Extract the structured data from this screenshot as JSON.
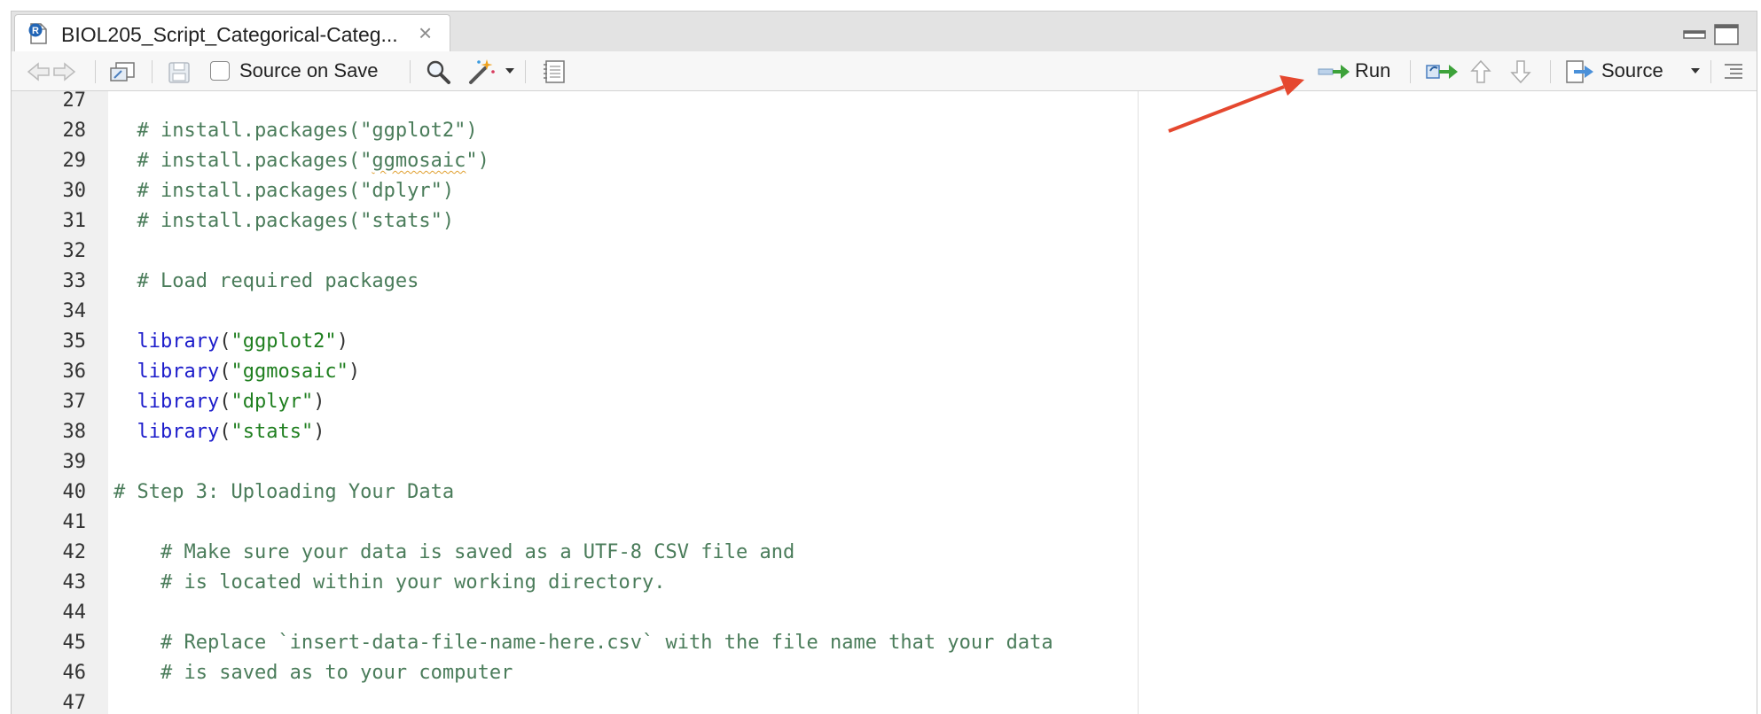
{
  "tab": {
    "title": "BIOL205_Script_Categorical-Categ...",
    "close_glyph": "×",
    "icon": "r-file-icon"
  },
  "toolbar": {
    "source_on_save_label": "Source on Save",
    "source_on_save_checked": false,
    "run_label": "Run",
    "source_label": "Source"
  },
  "editor": {
    "lines": [
      {
        "n": "27",
        "parts": []
      },
      {
        "n": "28",
        "parts": [
          {
            "t": "  # install.packages(\"ggplot2\")",
            "c": "comment"
          }
        ]
      },
      {
        "n": "29",
        "parts": [
          {
            "t": "  # install.packages(\"",
            "c": "comment"
          },
          {
            "t": "ggmosaic",
            "c": "comment squiggle"
          },
          {
            "t": "\")",
            "c": "comment"
          }
        ]
      },
      {
        "n": "30",
        "parts": [
          {
            "t": "  # install.packages(\"dplyr\")",
            "c": "comment"
          }
        ]
      },
      {
        "n": "31",
        "parts": [
          {
            "t": "  # install.packages(\"stats\")",
            "c": "comment"
          }
        ]
      },
      {
        "n": "32",
        "parts": []
      },
      {
        "n": "33",
        "parts": [
          {
            "t": "  # Load required packages",
            "c": "comment"
          }
        ]
      },
      {
        "n": "34",
        "parts": []
      },
      {
        "n": "35",
        "parts": [
          {
            "t": "  ",
            "c": "punc"
          },
          {
            "t": "library",
            "c": "func"
          },
          {
            "t": "(",
            "c": "punc"
          },
          {
            "t": "\"ggplot2\"",
            "c": "str"
          },
          {
            "t": ")",
            "c": "punc"
          }
        ]
      },
      {
        "n": "36",
        "parts": [
          {
            "t": "  ",
            "c": "punc"
          },
          {
            "t": "library",
            "c": "func"
          },
          {
            "t": "(",
            "c": "punc"
          },
          {
            "t": "\"ggmosaic\"",
            "c": "str"
          },
          {
            "t": ")",
            "c": "punc"
          }
        ]
      },
      {
        "n": "37",
        "parts": [
          {
            "t": "  ",
            "c": "punc"
          },
          {
            "t": "library",
            "c": "func"
          },
          {
            "t": "(",
            "c": "punc"
          },
          {
            "t": "\"dplyr\"",
            "c": "str"
          },
          {
            "t": ")",
            "c": "punc"
          }
        ]
      },
      {
        "n": "38",
        "parts": [
          {
            "t": "  ",
            "c": "punc"
          },
          {
            "t": "library",
            "c": "func"
          },
          {
            "t": "(",
            "c": "punc"
          },
          {
            "t": "\"stats\"",
            "c": "str"
          },
          {
            "t": ")",
            "c": "punc"
          }
        ]
      },
      {
        "n": "39",
        "parts": []
      },
      {
        "n": "40",
        "parts": [
          {
            "t": "# Step 3: Uploading Your Data",
            "c": "comment"
          }
        ]
      },
      {
        "n": "41",
        "parts": []
      },
      {
        "n": "42",
        "parts": [
          {
            "t": "    # Make sure your data is saved as a UTF-8 CSV file and",
            "c": "comment"
          }
        ]
      },
      {
        "n": "43",
        "parts": [
          {
            "t": "    # is located within your working directory.",
            "c": "comment"
          }
        ]
      },
      {
        "n": "44",
        "parts": []
      },
      {
        "n": "45",
        "parts": [
          {
            "t": "    # Replace `insert-data-file-name-here.csv` with the file name that your data",
            "c": "comment"
          }
        ]
      },
      {
        "n": "46",
        "parts": [
          {
            "t": "    # is saved as to your computer",
            "c": "comment"
          }
        ]
      },
      {
        "n": "47",
        "parts": []
      }
    ]
  },
  "colors": {
    "comment": "#4a7c5a",
    "function": "#1c1ccb",
    "string": "#1f7f1f",
    "annotation_arrow": "#e5482f"
  }
}
